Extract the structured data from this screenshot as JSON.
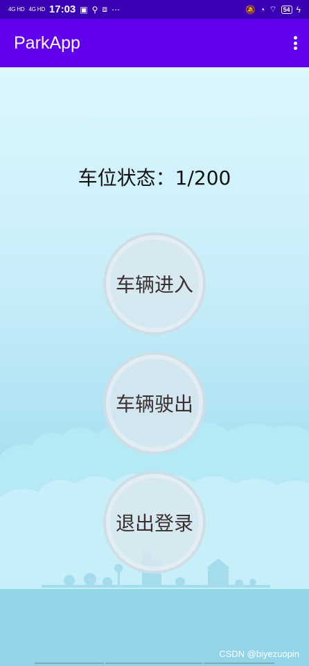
{
  "status_bar": {
    "signal_1": "4G HD",
    "signal_2": "4G HD",
    "time": "17:03",
    "battery": "54",
    "icons": [
      "signal-icon",
      "notification-icon",
      "usb-icon",
      "screenshot-icon",
      "more-icon",
      "mute-icon",
      "alarm-icon",
      "wifi-icon",
      "battery-icon",
      "charging-icon"
    ]
  },
  "app_bar": {
    "title": "ParkApp",
    "menu_icon": "overflow-menu-icon"
  },
  "main": {
    "parking_status": "车位状态：1/200",
    "buttons": {
      "enter": "车辆进入",
      "exit": "车辆驶出",
      "logout": "退出登录"
    }
  },
  "watermark": "CSDN @biyezuopin",
  "colors": {
    "status_bar": "#3a00b4",
    "app_bar": "#6200ee",
    "background_top": "#dcf7fd",
    "background_bottom": "#a6dff0"
  }
}
